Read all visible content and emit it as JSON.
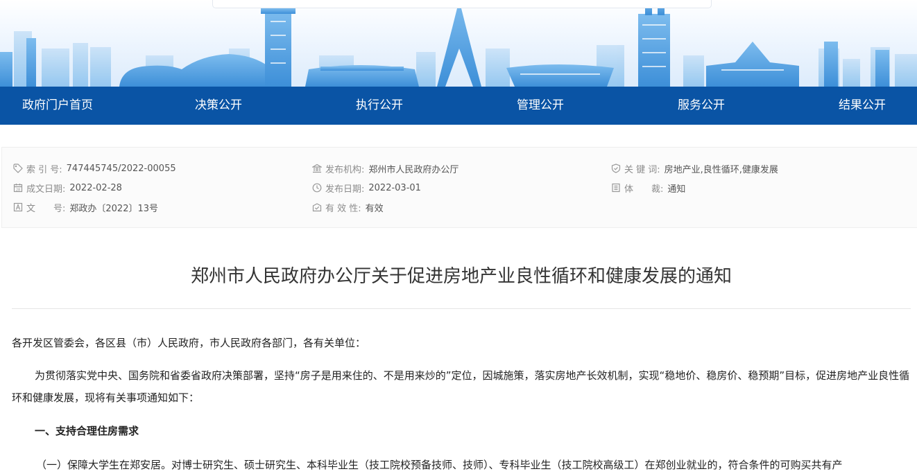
{
  "nav": {
    "items": [
      "政府门户首页",
      "决策公开",
      "执行公开",
      "管理公开",
      "服务公开",
      "结果公开"
    ]
  },
  "meta": {
    "index_label": "索 引 号:",
    "index_value": "747445745/2022-00055",
    "publisher_label": "发布机构:",
    "publisher_value": "郑州市人民政府办公厅",
    "keywords_label": "关 键 词:",
    "keywords_value": "房地产业,良性循环,健康发展",
    "written_label": "成文日期:",
    "written_value": "2022-02-28",
    "published_label": "发布日期:",
    "published_value": "2022-03-01",
    "genre_label": "体　　裁:",
    "genre_value": "通知",
    "docno_label": "文　　号:",
    "docno_value": "郑政办〔2022〕13号",
    "validity_label": "有 效 性:",
    "validity_value": "有效"
  },
  "document": {
    "title": "郑州市人民政府办公厅关于促进房地产业良性循环和健康发展的通知",
    "salutation": "各开发区管委会，各区县（市）人民政府，市人民政府各部门，各有关单位：",
    "intro": "为贯彻落实党中央、国务院和省委省政府决策部署，坚持“房子是用来住的、不是用来炒的”定位，因城施策，落实房地产长效机制，实现“稳地价、稳房价、稳预期”目标，促进房地产业良性循环和健康发展，现将有关事项通知如下：",
    "section_1": "一、支持合理住房需求",
    "item_1": "（一）保障大学生在郑安居。对博士研究生、硕士研究生、本科毕业生（技工院校预备技师、技师）、专科毕业生（技工院校高级工）在郑创业就业的，符合条件的可购买共有产"
  },
  "icons": {
    "index": "tag-icon",
    "publisher": "institution-icon",
    "keywords": "shield-check-icon",
    "written": "calendar-icon",
    "published": "clock-icon",
    "genre": "document-list-icon",
    "docno": "letter-a-icon",
    "validity": "checked-envelope-icon"
  },
  "colors": {
    "nav_bg": "#0a54a5",
    "banner_building": "#5aa3e3"
  }
}
